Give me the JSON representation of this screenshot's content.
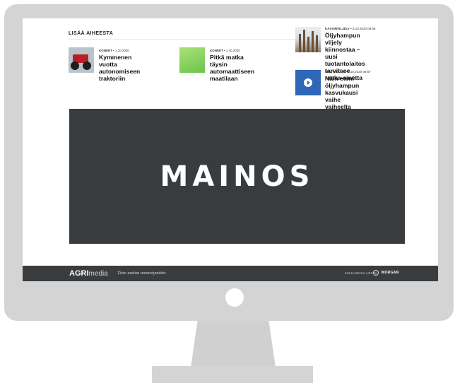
{
  "section": {
    "label": "LISÄÄ AIHEESTA"
  },
  "articles": [
    {
      "category": "KONEET",
      "date": "1.10.2020",
      "title_lines": [
        "Kymmenen vuotta",
        "autonomiseen traktoriin"
      ],
      "thumb_icon": "tractor-thumbnail"
    },
    {
      "category": "KONEET",
      "date": "1.10.2020",
      "title_lines": [
        "Pitkä matka täysin",
        "automaattiseen maatilaan"
      ],
      "thumb_icon": "field-thumbnail"
    },
    {
      "category": "KASVINVILJELY",
      "date": "6.10.2020 09:55",
      "title_lines": [
        "Öljyhampun viljely",
        "kiinnostaa – uusi",
        "tuotantolaitos tarvitsee",
        "raaka-ainetta"
      ],
      "thumb_icon": "hemp-thumbnail"
    },
    {
      "category": "MAATALOUS",
      "date": "6.10.2020 09:57",
      "title_lines": [
        "Näin eteni öljyhampun",
        "kasvukausi vaihe vaiheelta"
      ],
      "thumb_icon": "video-play-icon"
    }
  ],
  "ad": {
    "label": "MAINOS"
  },
  "footer": {
    "logo_bold": "AGRI",
    "logo_light": "media",
    "tagline": "Tieto auttaa menestymään.",
    "partners_label": "JULKAISIJALLESTA",
    "partner_name": "MORGAN"
  },
  "colors": {
    "footer_bg": "#3a3d40",
    "ad_bg": "#393c3e",
    "monitor": "#d4d4d4",
    "video_thumb": "#2f67b8"
  }
}
